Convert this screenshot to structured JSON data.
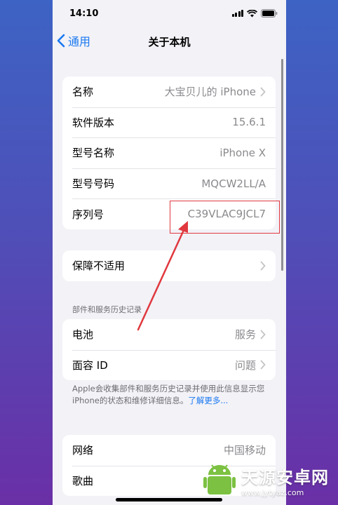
{
  "status_bar": {
    "time": "14:10"
  },
  "nav": {
    "back_label": "通用",
    "title": "关于本机"
  },
  "info_group": [
    {
      "label": "名称",
      "value": "大宝贝儿的 iPhone",
      "chevron": true
    },
    {
      "label": "软件版本",
      "value": "15.6.1"
    },
    {
      "label": "型号名称",
      "value": "iPhone X"
    },
    {
      "label": "型号号码",
      "value": "MQCW2LL/A"
    },
    {
      "label": "序列号",
      "value": "C39VLAC9JCL7"
    }
  ],
  "warranty": {
    "label": "保障不适用"
  },
  "parts_section": {
    "header": "部件和服务历史记录",
    "rows": [
      {
        "label": "电池",
        "value": "服务"
      },
      {
        "label": "面容 ID",
        "value": "问题"
      }
    ],
    "footnote_text": "Apple会收集部件和服务历史记录并使用此信息显示您 iPhone的状态和维修详细信息。",
    "footnote_link": "了解更多..."
  },
  "network_group": [
    {
      "label": "网络",
      "value": "中国移动"
    },
    {
      "label": "歌曲",
      "value": ""
    }
  ],
  "annotation": {
    "color": "#e0383e"
  },
  "watermark": {
    "title": "天源安卓网",
    "url": "www.jytyaz.com"
  },
  "colors": {
    "accent": "#1a78f0",
    "background": "#f2f2f7"
  }
}
